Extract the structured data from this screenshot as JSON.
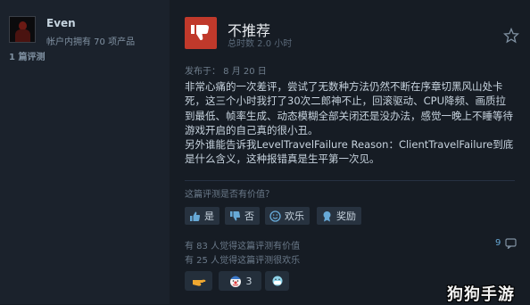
{
  "author": {
    "name": "Even",
    "products_owned": "帐户内拥有 70 项产品",
    "review_count": "1 篇评测"
  },
  "review": {
    "verdict": "不推荐",
    "hours": "总时数 2.0 小时",
    "posted": "发布于： 8 月 20 日",
    "paragraphs": [
      "非常心痛的一次差评，尝试了无数种方法仍然不断在序章切黑风山处卡死，这三个小时我打了30次二郎神不止，回滚驱动、CPU降频、画质拉到最低、帧率生成、动态模糊全部关闭还是没办法，感觉一晚上不睡等待游戏开启的自己真的很小丑。",
      "另外谁能告诉我LevelTravelFailure Reason：ClientTravelFailure到底是什么含义，这种报错真是生平第一次见。"
    ]
  },
  "helpful": {
    "question": "这篇评测是否有价值？",
    "yes_label": "是",
    "no_label": "否",
    "funny_label": "欢乐",
    "award_label": "奖励",
    "helpful_stat": "有 83 人觉得这篇评测有价值",
    "funny_stat": "有 25 人觉得这篇评测很欢乐",
    "award_count": "9"
  },
  "reactions": [
    {
      "icon": "hand-pointing-icon",
      "count": ""
    },
    {
      "icon": "clown-face-icon",
      "count": "3"
    },
    {
      "icon": "face-mask-icon",
      "count": ""
    }
  ],
  "watermark": "狗狗手游",
  "colors": {
    "background": "#161c24",
    "sidebar": "#1b222c",
    "thumbs_down_box": "#c0392b",
    "award_accent": "#67a9d7",
    "button_bg": "#27323f"
  }
}
